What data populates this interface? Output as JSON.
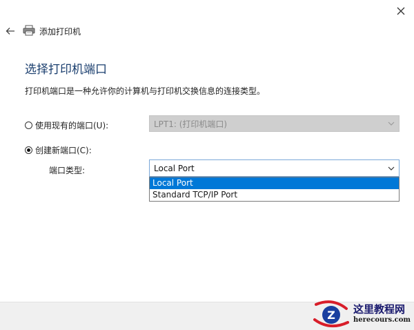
{
  "window": {
    "title": "添加打印机",
    "close_glyph": "✕",
    "back_glyph": "←"
  },
  "page": {
    "heading": "选择打印机端口",
    "description": "打印机端口是一种允许你的计算机与打印机交换信息的连接类型。"
  },
  "options": {
    "existing_port": {
      "label": "使用现有的端口(U):",
      "checked": false,
      "select_value": "LPT1: (打印机端口)",
      "disabled": true
    },
    "new_port": {
      "label": "创建新端口(C):",
      "checked": true,
      "type_label": "端口类型:",
      "select_value": "Local Port",
      "dropdown_options": [
        "Local Port",
        "Standard TCP/IP Port"
      ],
      "highlighted_index": 0
    }
  },
  "watermark": {
    "title": "这里教程网",
    "url": "herecours.com",
    "logo_letter": "Z"
  },
  "colors": {
    "heading": "#1a3e6e",
    "highlight": "#0078d7",
    "footer": "#f0f0f0",
    "watermark_red": "#d81e2a",
    "watermark_blue": "#1a3fa0"
  }
}
